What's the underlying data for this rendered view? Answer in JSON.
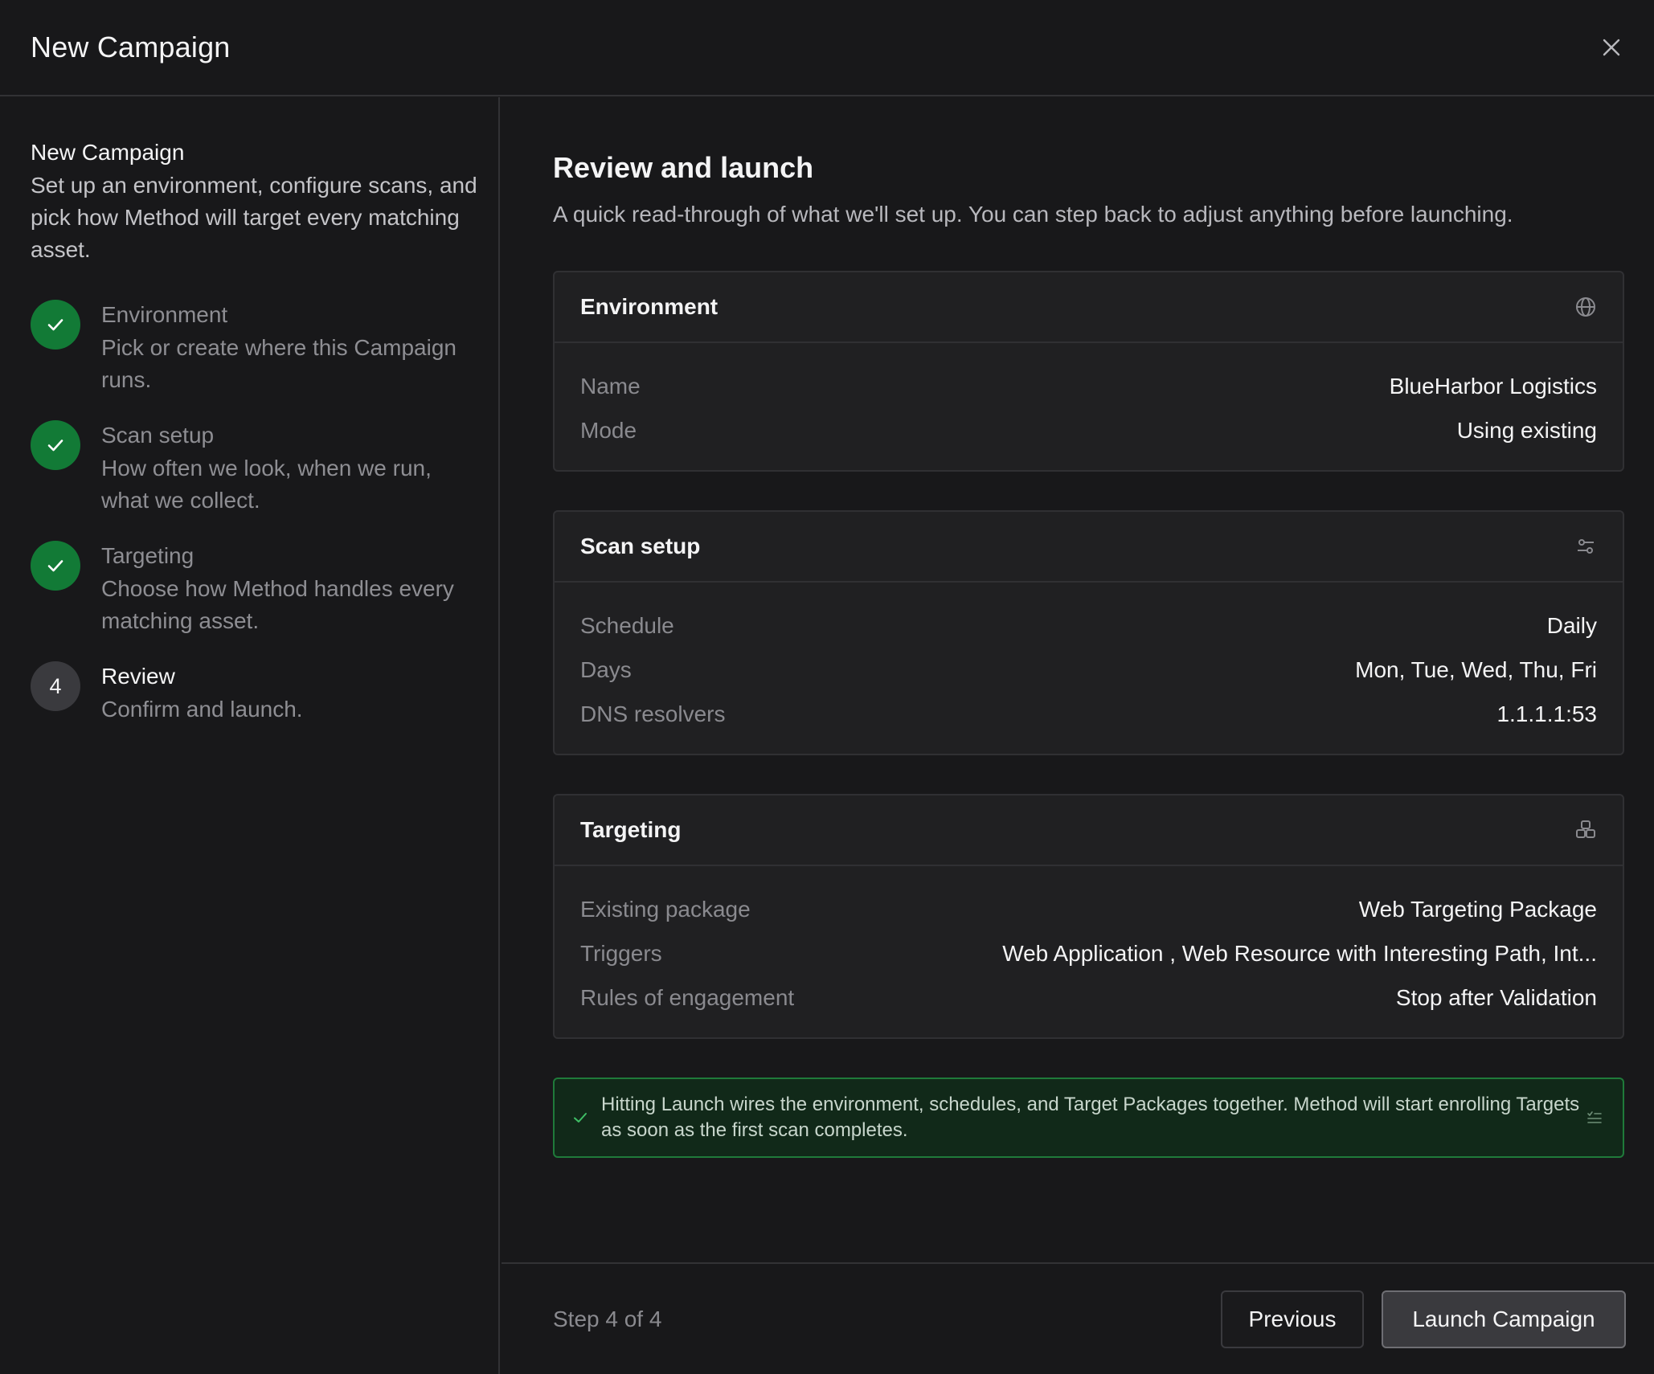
{
  "header": {
    "title": "New Campaign"
  },
  "sidebar": {
    "title": "New Campaign",
    "description": "Set up an environment, configure scans, and pick how Method will target every matching asset.",
    "steps": [
      {
        "number": "1",
        "title": "Environment",
        "description": "Pick or create where this Campaign runs.",
        "status": "done"
      },
      {
        "number": "2",
        "title": "Scan setup",
        "description": "How often we look, when we run, what we collect.",
        "status": "done"
      },
      {
        "number": "3",
        "title": "Targeting",
        "description": "Choose how Method handles every matching asset.",
        "status": "done"
      },
      {
        "number": "4",
        "title": "Review",
        "description": "Confirm and launch.",
        "status": "current"
      }
    ]
  },
  "main": {
    "title": "Review and launch",
    "subtitle": "A quick read-through of what we'll set up. You can step back to adjust anything before launching.",
    "sections": [
      {
        "title": "Environment",
        "icon": "globe-icon",
        "rows": [
          {
            "label": "Name",
            "value": "BlueHarbor Logistics"
          },
          {
            "label": "Mode",
            "value": "Using existing"
          }
        ]
      },
      {
        "title": "Scan setup",
        "icon": "sliders-icon",
        "rows": [
          {
            "label": "Schedule",
            "value": "Daily"
          },
          {
            "label": "Days",
            "value": "Mon, Tue, Wed, Thu, Fri"
          },
          {
            "label": "DNS resolvers",
            "value": "1.1.1.1:53"
          }
        ]
      },
      {
        "title": "Targeting",
        "icon": "boxes-icon",
        "rows": [
          {
            "label": "Existing package",
            "value": "Web Targeting Package"
          },
          {
            "label": "Triggers",
            "value": "Web Application , Web Resource with Interesting Path, Int..."
          },
          {
            "label": "Rules of engagement",
            "value": "Stop after Validation"
          }
        ]
      }
    ],
    "notice": "Hitting Launch wires the environment, schedules, and Target Packages together. Method will start enrolling Targets as soon as the first scan completes."
  },
  "footer": {
    "step_count": "Step 4 of 4",
    "previous_label": "Previous",
    "launch_label": "Launch Campaign"
  },
  "colors": {
    "background": "#18181a",
    "card": "#202022",
    "success": "#127a36",
    "notice_border": "#1f7a3a",
    "notice_bg": "#112919"
  }
}
